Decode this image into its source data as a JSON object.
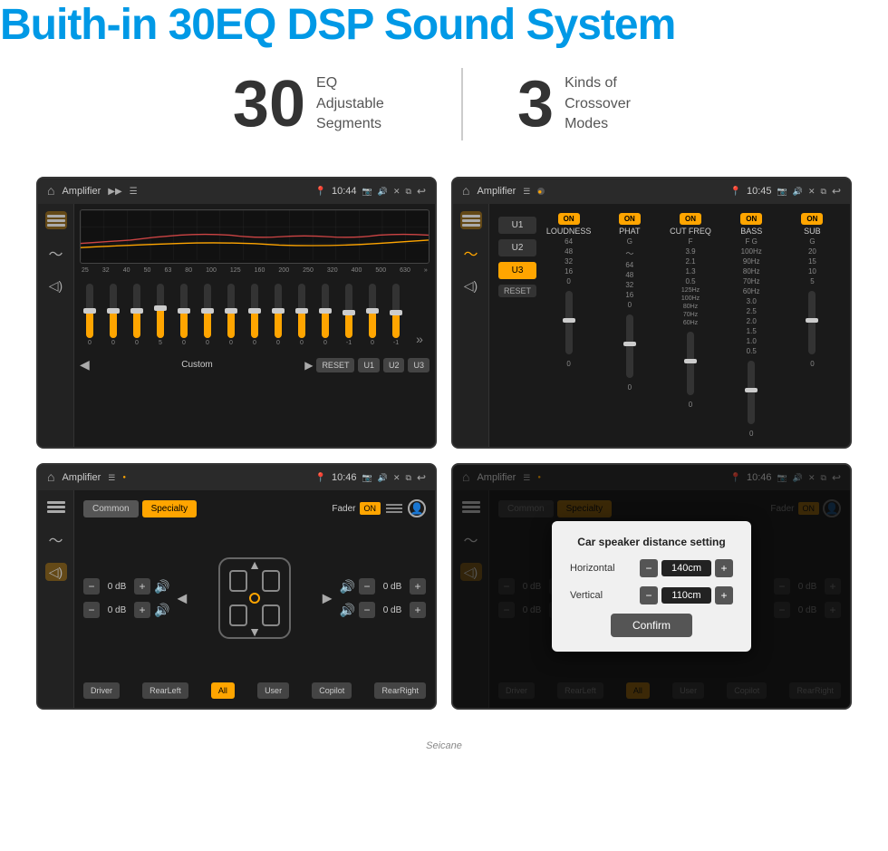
{
  "header": {
    "title": "Buith-in 30EQ DSP Sound System"
  },
  "stats": [
    {
      "number": "30",
      "label": "EQ Adjustable\nSegments"
    },
    {
      "number": "3",
      "label": "Kinds of\nCrossover Modes"
    }
  ],
  "screen1": {
    "title": "Amplifier",
    "time": "10:44",
    "preset": "Custom",
    "freqs": [
      "25",
      "32",
      "40",
      "50",
      "63",
      "80",
      "100",
      "125",
      "160",
      "200",
      "250",
      "320",
      "400",
      "500",
      "630"
    ],
    "vals": [
      "0",
      "0",
      "0",
      "5",
      "0",
      "0",
      "0",
      "0",
      "0",
      "0",
      "0",
      "-1",
      "0",
      "-1"
    ],
    "buttons": [
      "RESET",
      "U1",
      "U2",
      "U3"
    ]
  },
  "screen2": {
    "title": "Amplifier",
    "time": "10:45",
    "channels": [
      {
        "name": "LOUDNESS",
        "state": "ON"
      },
      {
        "name": "PHAT",
        "state": "ON"
      },
      {
        "name": "CUT FREQ",
        "state": "ON"
      },
      {
        "name": "BASS",
        "state": "ON"
      },
      {
        "name": "SUB",
        "state": "ON"
      }
    ],
    "presets": [
      "U1",
      "U2",
      "U3"
    ],
    "active_preset": "U3",
    "reset_label": "RESET"
  },
  "screen3": {
    "title": "Amplifier",
    "time": "10:46",
    "tabs": [
      "Common",
      "Specialty"
    ],
    "active_tab": "Specialty",
    "fader_label": "Fader",
    "fader_state": "ON",
    "zones": [
      {
        "label": "0 dB"
      },
      {
        "label": "0 dB"
      },
      {
        "label": "0 dB"
      },
      {
        "label": "0 dB"
      }
    ],
    "speaker_btns": [
      "Driver",
      "RearLeft",
      "All",
      "User",
      "Copilot",
      "RearRight"
    ]
  },
  "screen4": {
    "title": "Amplifier",
    "time": "10:46",
    "dialog": {
      "title": "Car speaker distance setting",
      "horizontal_label": "Horizontal",
      "horizontal_val": "140cm",
      "vertical_label": "Vertical",
      "vertical_val": "110cm",
      "confirm_label": "Confirm"
    },
    "speaker_btns": [
      "Driver",
      "RearLeft",
      "All",
      "User",
      "Copilot",
      "RearRight"
    ]
  },
  "watermark": "Seicane"
}
